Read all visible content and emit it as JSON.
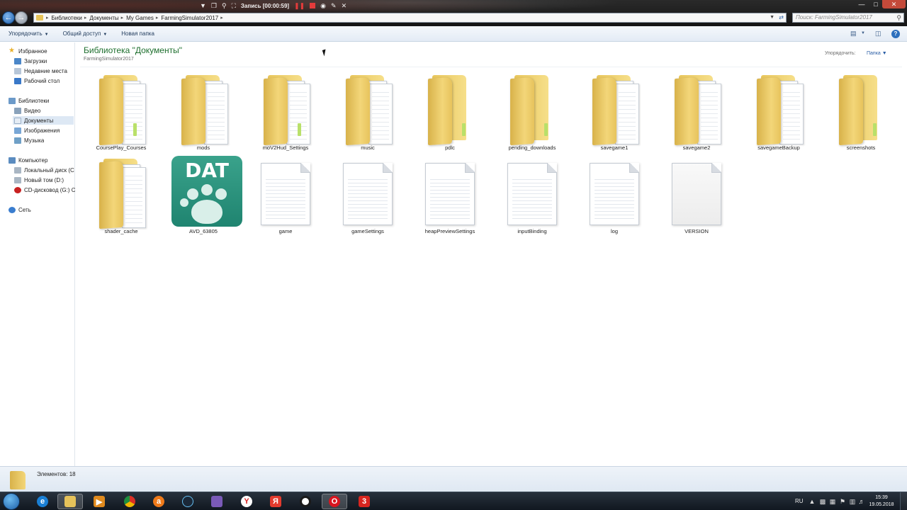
{
  "window": {
    "breadcrumbs": [
      "Библиотеки",
      "Документы",
      "My Games",
      "FarmingSimulator2017"
    ],
    "search_placeholder": "Поиск: FarmingSimulator2017",
    "recorder_label": "Запись [00:00:59]"
  },
  "toolbar": {
    "organize": "Упорядочить",
    "share": "Общий доступ",
    "new_folder": "Новая папка"
  },
  "nav": {
    "favorites": {
      "header": "Избранное",
      "items": [
        "Загрузки",
        "Недавние места",
        "Рабочий стол"
      ]
    },
    "libraries": {
      "header": "Библиотеки",
      "items": [
        "Видео",
        "Документы",
        "Изображения",
        "Музыка"
      ],
      "selected": "Документы"
    },
    "computer": {
      "header": "Компьютер",
      "items": [
        "Локальный диск (C",
        "Новый том (D:)",
        "CD-дисковод (G:) C"
      ]
    },
    "network": {
      "header": "Сеть"
    }
  },
  "content": {
    "title": "Библиотека \"Документы\"",
    "subtitle": "FarmingSimulator2017",
    "arrange_label": "Упорядочить:",
    "arrange_value": "Папка",
    "items": [
      {
        "name": "CoursePlay_Courses",
        "type": "folder"
      },
      {
        "name": "mods",
        "type": "folder"
      },
      {
        "name": "moV2Hud_Settings",
        "type": "folder"
      },
      {
        "name": "music",
        "type": "folder"
      },
      {
        "name": "pdlc",
        "type": "folder-empty"
      },
      {
        "name": "pending_downloads",
        "type": "folder-empty"
      },
      {
        "name": "savegame1",
        "type": "folder"
      },
      {
        "name": "savegame2",
        "type": "folder"
      },
      {
        "name": "savegameBackup",
        "type": "folder"
      },
      {
        "name": "screenshots",
        "type": "folder-empty"
      },
      {
        "name": "shader_cache",
        "type": "folder"
      },
      {
        "name": "AVD_63805",
        "type": "dat"
      },
      {
        "name": "game",
        "type": "doc"
      },
      {
        "name": "gameSettings",
        "type": "doc"
      },
      {
        "name": "heapPreviewSettings",
        "type": "doc"
      },
      {
        "name": "inputBinding",
        "type": "doc"
      },
      {
        "name": "log",
        "type": "doc"
      },
      {
        "name": "VERSION",
        "type": "blank"
      }
    ],
    "dat_icon_text": "DAT"
  },
  "status": {
    "text": "Элементов: 18"
  },
  "taskbar": {
    "language": "RU",
    "time": "15:39",
    "date": "19.05.2018"
  },
  "colors": {
    "title_green": "#1e6f2e",
    "selection": "#dde8f4",
    "folder_yellow": "#f3d679",
    "dat_green": "#2a9580"
  }
}
